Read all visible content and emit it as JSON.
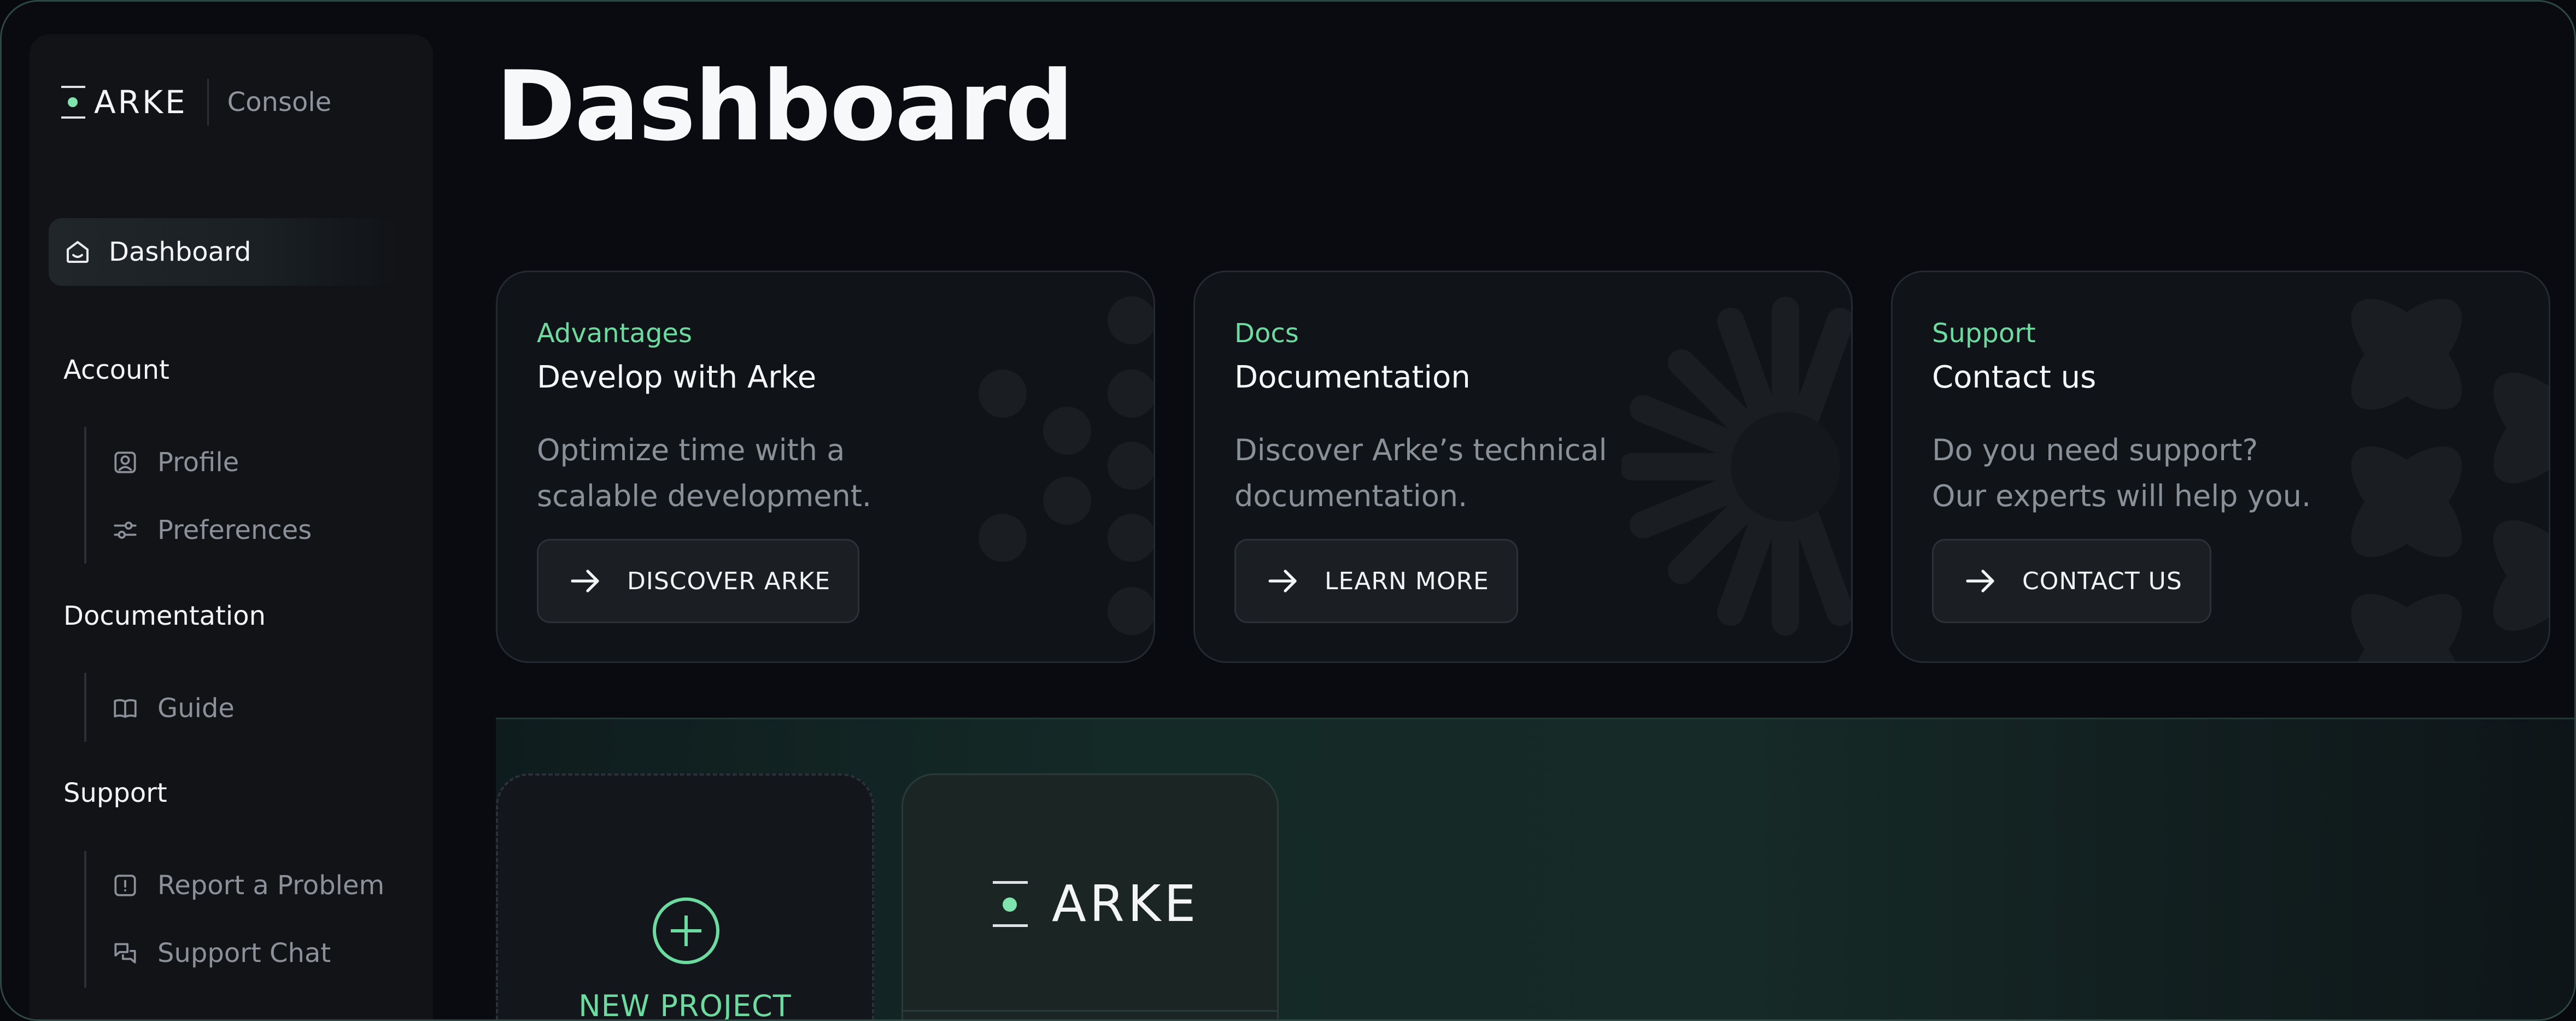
{
  "brand": {
    "name": "ARKE",
    "product": "Console"
  },
  "sidebar": {
    "active": {
      "label": "Dashboard",
      "icon": "home-icon"
    },
    "sections": [
      {
        "title": "Account",
        "items": [
          {
            "label": "Profile",
            "icon": "user-icon"
          },
          {
            "label": "Preferences",
            "icon": "sliders-icon"
          }
        ]
      },
      {
        "title": "Documentation",
        "items": [
          {
            "label": "Guide",
            "icon": "book-icon"
          }
        ]
      },
      {
        "title": "Support",
        "items": [
          {
            "label": "Report a Problem",
            "icon": "alert-icon"
          },
          {
            "label": "Support Chat",
            "icon": "chat-icon"
          }
        ]
      }
    ]
  },
  "page": {
    "title": "Dashboard"
  },
  "cards": [
    {
      "kicker": "Advantages",
      "heading": "Develop with Arke",
      "desc_line1": "Optimize time with a",
      "desc_line2": "scalable development.",
      "button": "DISCOVER ARKE"
    },
    {
      "kicker": "Docs",
      "heading": "Documentation",
      "desc_line1": "Discover Arke’s technical",
      "desc_line2": "documentation.",
      "button": "LEARN MORE"
    },
    {
      "kicker": "Support",
      "heading": "Contact us",
      "desc_line1": "Do you need support?",
      "desc_line2": "Our experts will help you.",
      "button": "CONTACT US"
    }
  ],
  "projects": {
    "new_label": "NEW PROJECT",
    "items": [
      {
        "name": "ARKE"
      }
    ]
  },
  "colors": {
    "accent": "#6ddba0",
    "background": "#090b11",
    "card": "#101317"
  }
}
